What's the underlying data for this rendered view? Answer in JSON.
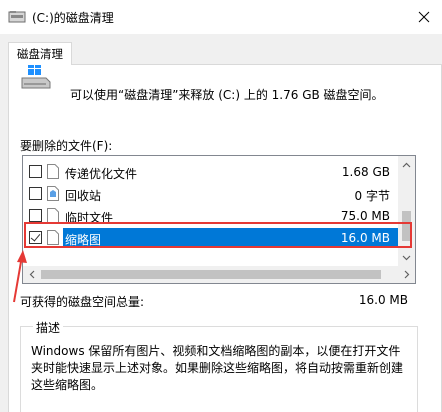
{
  "window": {
    "title": "(C:)的磁盘清理"
  },
  "tab": {
    "label": "磁盘清理"
  },
  "header": {
    "info_text": "可以使用“磁盘清理”来释放 (C:) 上的 1.76 GB 磁盘空间。"
  },
  "files_label": "要删除的文件(F):",
  "files": [
    {
      "name": "传递优化文件",
      "size": "1.68 GB",
      "checked": false,
      "selected": false
    },
    {
      "name": "回收站",
      "size": "0 字节",
      "checked": false,
      "selected": false
    },
    {
      "name": "临时文件",
      "size": "75.0 MB",
      "checked": false,
      "selected": false
    },
    {
      "name": "缩略图",
      "size": "16.0 MB",
      "checked": true,
      "selected": true
    }
  ],
  "total": {
    "label": "可获得的磁盘空间总量:",
    "value": "16.0 MB"
  },
  "description": {
    "title": "描述",
    "text": "Windows 保留所有图片、视频和文档缩略图的副本，以便在打开文件夹时能快速显示上述对象。如果删除这些缩略图，将自动按需重新创建这些缩略图。"
  },
  "colors": {
    "selection": "#0078d7",
    "annotation": "#e53935"
  }
}
